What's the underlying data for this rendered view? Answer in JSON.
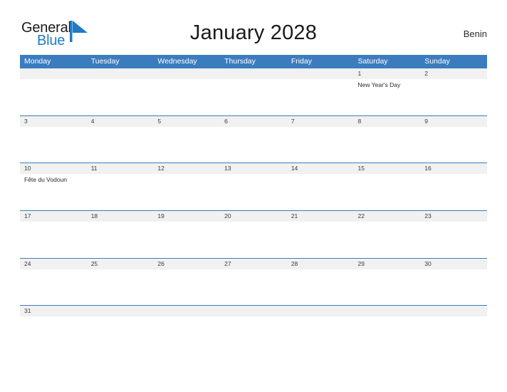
{
  "brand": {
    "name_part1": "General",
    "name_part2": "Blue",
    "flag_color": "#1f7ac4"
  },
  "header": {
    "title": "January 2028",
    "country": "Benin"
  },
  "theme": {
    "header_blue": "#3b7cbf",
    "band_gray": "#f1f1f1",
    "text_dark": "#2a2a2a"
  },
  "weekdays": [
    "Monday",
    "Tuesday",
    "Wednesday",
    "Thursday",
    "Friday",
    "Saturday",
    "Sunday"
  ],
  "weeks": [
    {
      "days": [
        {
          "num": "",
          "events": []
        },
        {
          "num": "",
          "events": []
        },
        {
          "num": "",
          "events": []
        },
        {
          "num": "",
          "events": []
        },
        {
          "num": "",
          "events": []
        },
        {
          "num": "1",
          "events": [
            "New Year's Day"
          ]
        },
        {
          "num": "2",
          "events": []
        }
      ]
    },
    {
      "days": [
        {
          "num": "3",
          "events": []
        },
        {
          "num": "4",
          "events": []
        },
        {
          "num": "5",
          "events": []
        },
        {
          "num": "6",
          "events": []
        },
        {
          "num": "7",
          "events": []
        },
        {
          "num": "8",
          "events": []
        },
        {
          "num": "9",
          "events": []
        }
      ]
    },
    {
      "days": [
        {
          "num": "10",
          "events": [
            "Fête du Vodoun"
          ]
        },
        {
          "num": "11",
          "events": []
        },
        {
          "num": "12",
          "events": []
        },
        {
          "num": "13",
          "events": []
        },
        {
          "num": "14",
          "events": []
        },
        {
          "num": "15",
          "events": []
        },
        {
          "num": "16",
          "events": []
        }
      ]
    },
    {
      "days": [
        {
          "num": "17",
          "events": []
        },
        {
          "num": "18",
          "events": []
        },
        {
          "num": "19",
          "events": []
        },
        {
          "num": "20",
          "events": []
        },
        {
          "num": "21",
          "events": []
        },
        {
          "num": "22",
          "events": []
        },
        {
          "num": "23",
          "events": []
        }
      ]
    },
    {
      "days": [
        {
          "num": "24",
          "events": []
        },
        {
          "num": "25",
          "events": []
        },
        {
          "num": "26",
          "events": []
        },
        {
          "num": "27",
          "events": []
        },
        {
          "num": "28",
          "events": []
        },
        {
          "num": "29",
          "events": []
        },
        {
          "num": "30",
          "events": []
        }
      ]
    },
    {
      "days": [
        {
          "num": "31",
          "events": []
        },
        {
          "num": "",
          "events": []
        },
        {
          "num": "",
          "events": []
        },
        {
          "num": "",
          "events": []
        },
        {
          "num": "",
          "events": []
        },
        {
          "num": "",
          "events": []
        },
        {
          "num": "",
          "events": []
        }
      ]
    }
  ]
}
